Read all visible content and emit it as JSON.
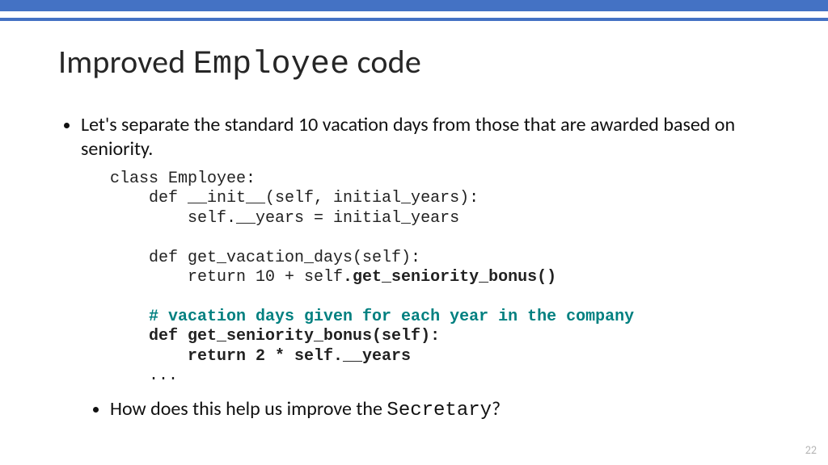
{
  "title": {
    "pre": "Improved ",
    "mono": "Employee",
    "post": " code"
  },
  "bullets": {
    "b1": "Let's separate the standard 10 vacation days from those that are awarded based on seniority.",
    "b2_pre": "How does this help us improve the ",
    "b2_mono": "Secretary",
    "b2_post": "?"
  },
  "code": {
    "l1": "class Employee:",
    "l2": "    def __init__(self, initial_years):",
    "l3": "        self.__years = initial_years",
    "l4": "",
    "l5": "    def get_vacation_days(self):",
    "l6a": "        return 10 + self",
    "l6b": ".get_seniority_bonus()",
    "l7": "",
    "l8": "    # vacation days given for each year in the company",
    "l9": "    def get_seniority_bonus(self):",
    "l10": "        return 2 * self.__years",
    "l11": "    ..."
  },
  "page_number": "22"
}
